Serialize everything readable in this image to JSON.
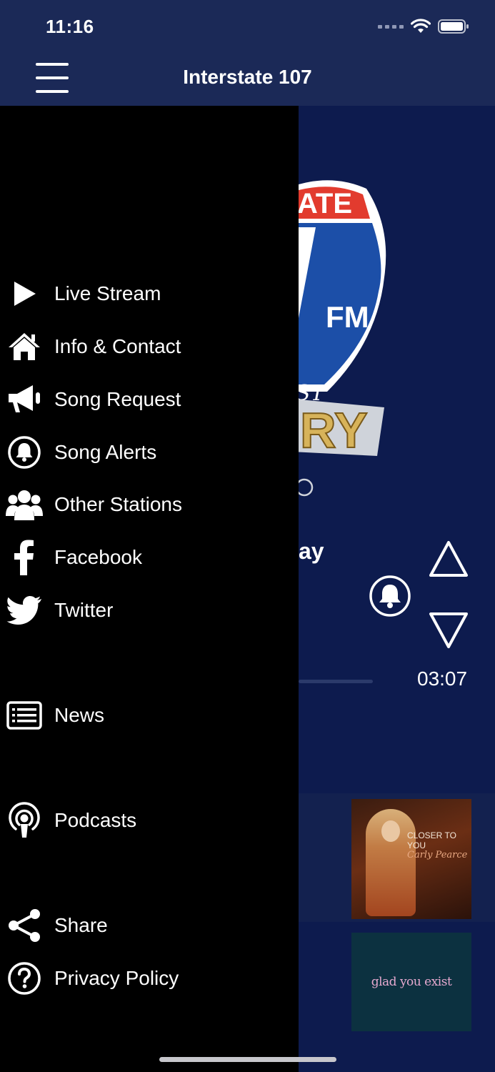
{
  "status_bar": {
    "time": "11:16"
  },
  "header": {
    "title": "Interstate 107"
  },
  "drawer": {
    "items": [
      {
        "label": "Live Stream",
        "icon": "play-icon"
      },
      {
        "label": "Info & Contact",
        "icon": "home-icon"
      },
      {
        "label": "Song Request",
        "icon": "megaphone-icon"
      },
      {
        "label": "Song Alerts",
        "icon": "bell-icon"
      },
      {
        "label": "Other Stations",
        "icon": "group-icon"
      },
      {
        "label": "Facebook",
        "icon": "facebook-icon"
      },
      {
        "label": "Twitter",
        "icon": "twitter-icon"
      },
      {
        "label": "News",
        "icon": "news-icon"
      },
      {
        "label": "Podcasts",
        "icon": "podcast-icon"
      },
      {
        "label": "Share",
        "icon": "share-icon"
      },
      {
        "label": "Privacy Policy",
        "icon": "help-icon"
      }
    ]
  },
  "player": {
    "logo_text_top": "ATE",
    "logo_text_fm": "FM",
    "logo_text_bottom": "RY",
    "logo_text_small": "ST",
    "song_title_fragment": "ay",
    "time_remaining": "03:07"
  },
  "recent": [
    {
      "cover_title": "CLOSER TO YOU",
      "cover_artist": "Carly Pearce"
    },
    {
      "cover_title": "glad you exist"
    }
  ],
  "colors": {
    "header_bg": "#1b2957",
    "player_bg": "#0d1b4e",
    "drawer_bg": "#000000",
    "logo_red": "#e23b2e",
    "logo_blue": "#1c4fa8",
    "logo_gold": "#d7b35a"
  }
}
